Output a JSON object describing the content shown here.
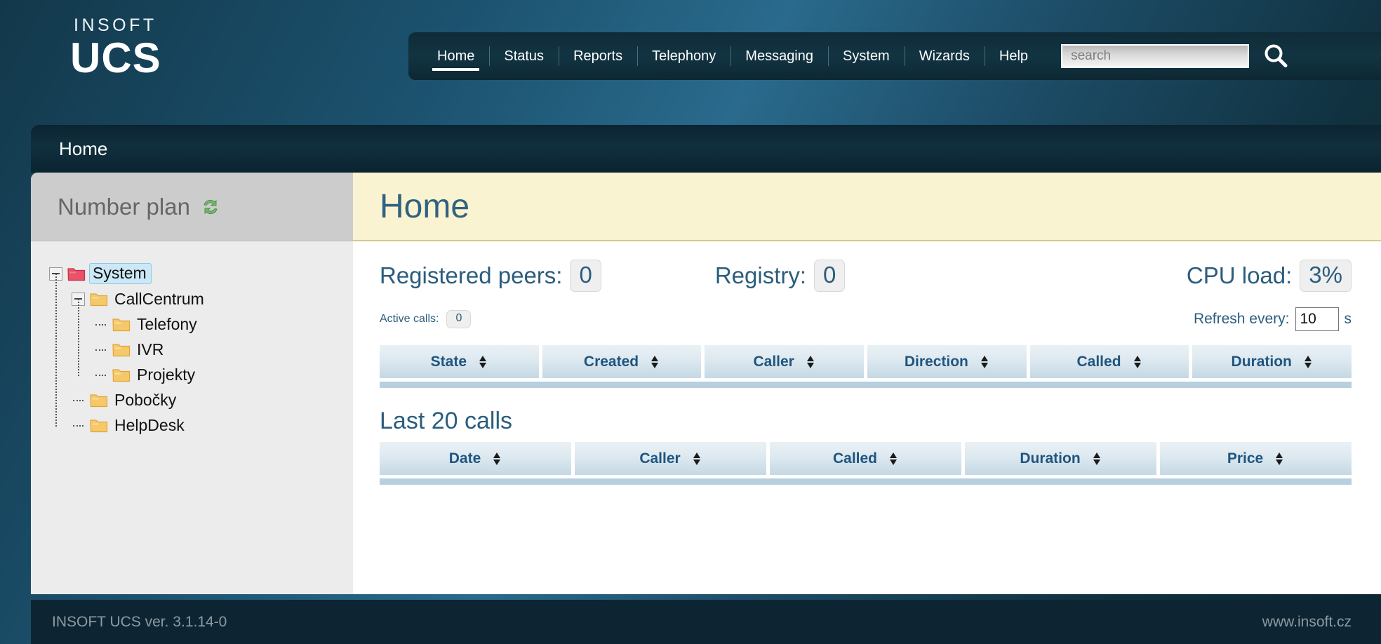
{
  "brand": {
    "logo_top": "INSOFT",
    "logo_main": "UCS"
  },
  "nav": {
    "items": [
      {
        "label": "Home",
        "active": true
      },
      {
        "label": "Status",
        "active": false
      },
      {
        "label": "Reports",
        "active": false
      },
      {
        "label": "Telephony",
        "active": false
      },
      {
        "label": "Messaging",
        "active": false
      },
      {
        "label": "System",
        "active": false
      },
      {
        "label": "Wizards",
        "active": false
      },
      {
        "label": "Help",
        "active": false
      }
    ],
    "search": {
      "placeholder": "search",
      "value": "",
      "icon": "search-icon"
    }
  },
  "breadcrumb": {
    "text": "Home"
  },
  "sidebar": {
    "title": "Number plan",
    "refresh_icon": "refresh-icon",
    "tree": [
      {
        "label": "System",
        "level": 0,
        "icon": "folder-red-icon",
        "selected": true,
        "expander": "minus"
      },
      {
        "label": "CallCentrum",
        "level": 1,
        "icon": "folder-yellow-icon",
        "selected": false,
        "expander": "minus"
      },
      {
        "label": "Telefony",
        "level": 2,
        "icon": "folder-yellow-icon",
        "selected": false,
        "expander": "none"
      },
      {
        "label": "IVR",
        "level": 2,
        "icon": "folder-yellow-icon",
        "selected": false,
        "expander": "none"
      },
      {
        "label": "Projekty",
        "level": 2,
        "icon": "folder-yellow-icon",
        "selected": false,
        "expander": "none"
      },
      {
        "label": "Pobočky",
        "level": 1,
        "icon": "folder-yellow-icon",
        "selected": false,
        "expander": "none"
      },
      {
        "label": "HelpDesk",
        "level": 1,
        "icon": "folder-yellow-icon",
        "selected": false,
        "expander": "none"
      }
    ]
  },
  "main": {
    "title": "Home",
    "stats": {
      "registered_peers_label": "Registered peers:",
      "registered_peers_value": "0",
      "registry_label": "Registry:",
      "registry_value": "0",
      "cpu_load_label": "CPU load:",
      "cpu_load_value": "3%",
      "active_calls_label": "Active calls:",
      "active_calls_value": "0"
    },
    "refresh": {
      "label": "Refresh every:",
      "value": "10",
      "unit": "s"
    },
    "active_calls_table": {
      "columns": [
        "State",
        "Created",
        "Caller",
        "Direction",
        "Called",
        "Duration"
      ],
      "rows": []
    },
    "last_calls_title": "Last 20 calls",
    "last_calls_table": {
      "columns": [
        "Date",
        "Caller",
        "Called",
        "Duration",
        "Price"
      ],
      "rows": []
    }
  },
  "footer": {
    "left": "INSOFT UCS ver. 3.1.14-0",
    "right": "www.insoft.cz"
  },
  "colors": {
    "accent": "#2b5d7d",
    "banner": "#faf3d2",
    "header_dark": "#0d2532",
    "selection": "#cce8f6"
  }
}
